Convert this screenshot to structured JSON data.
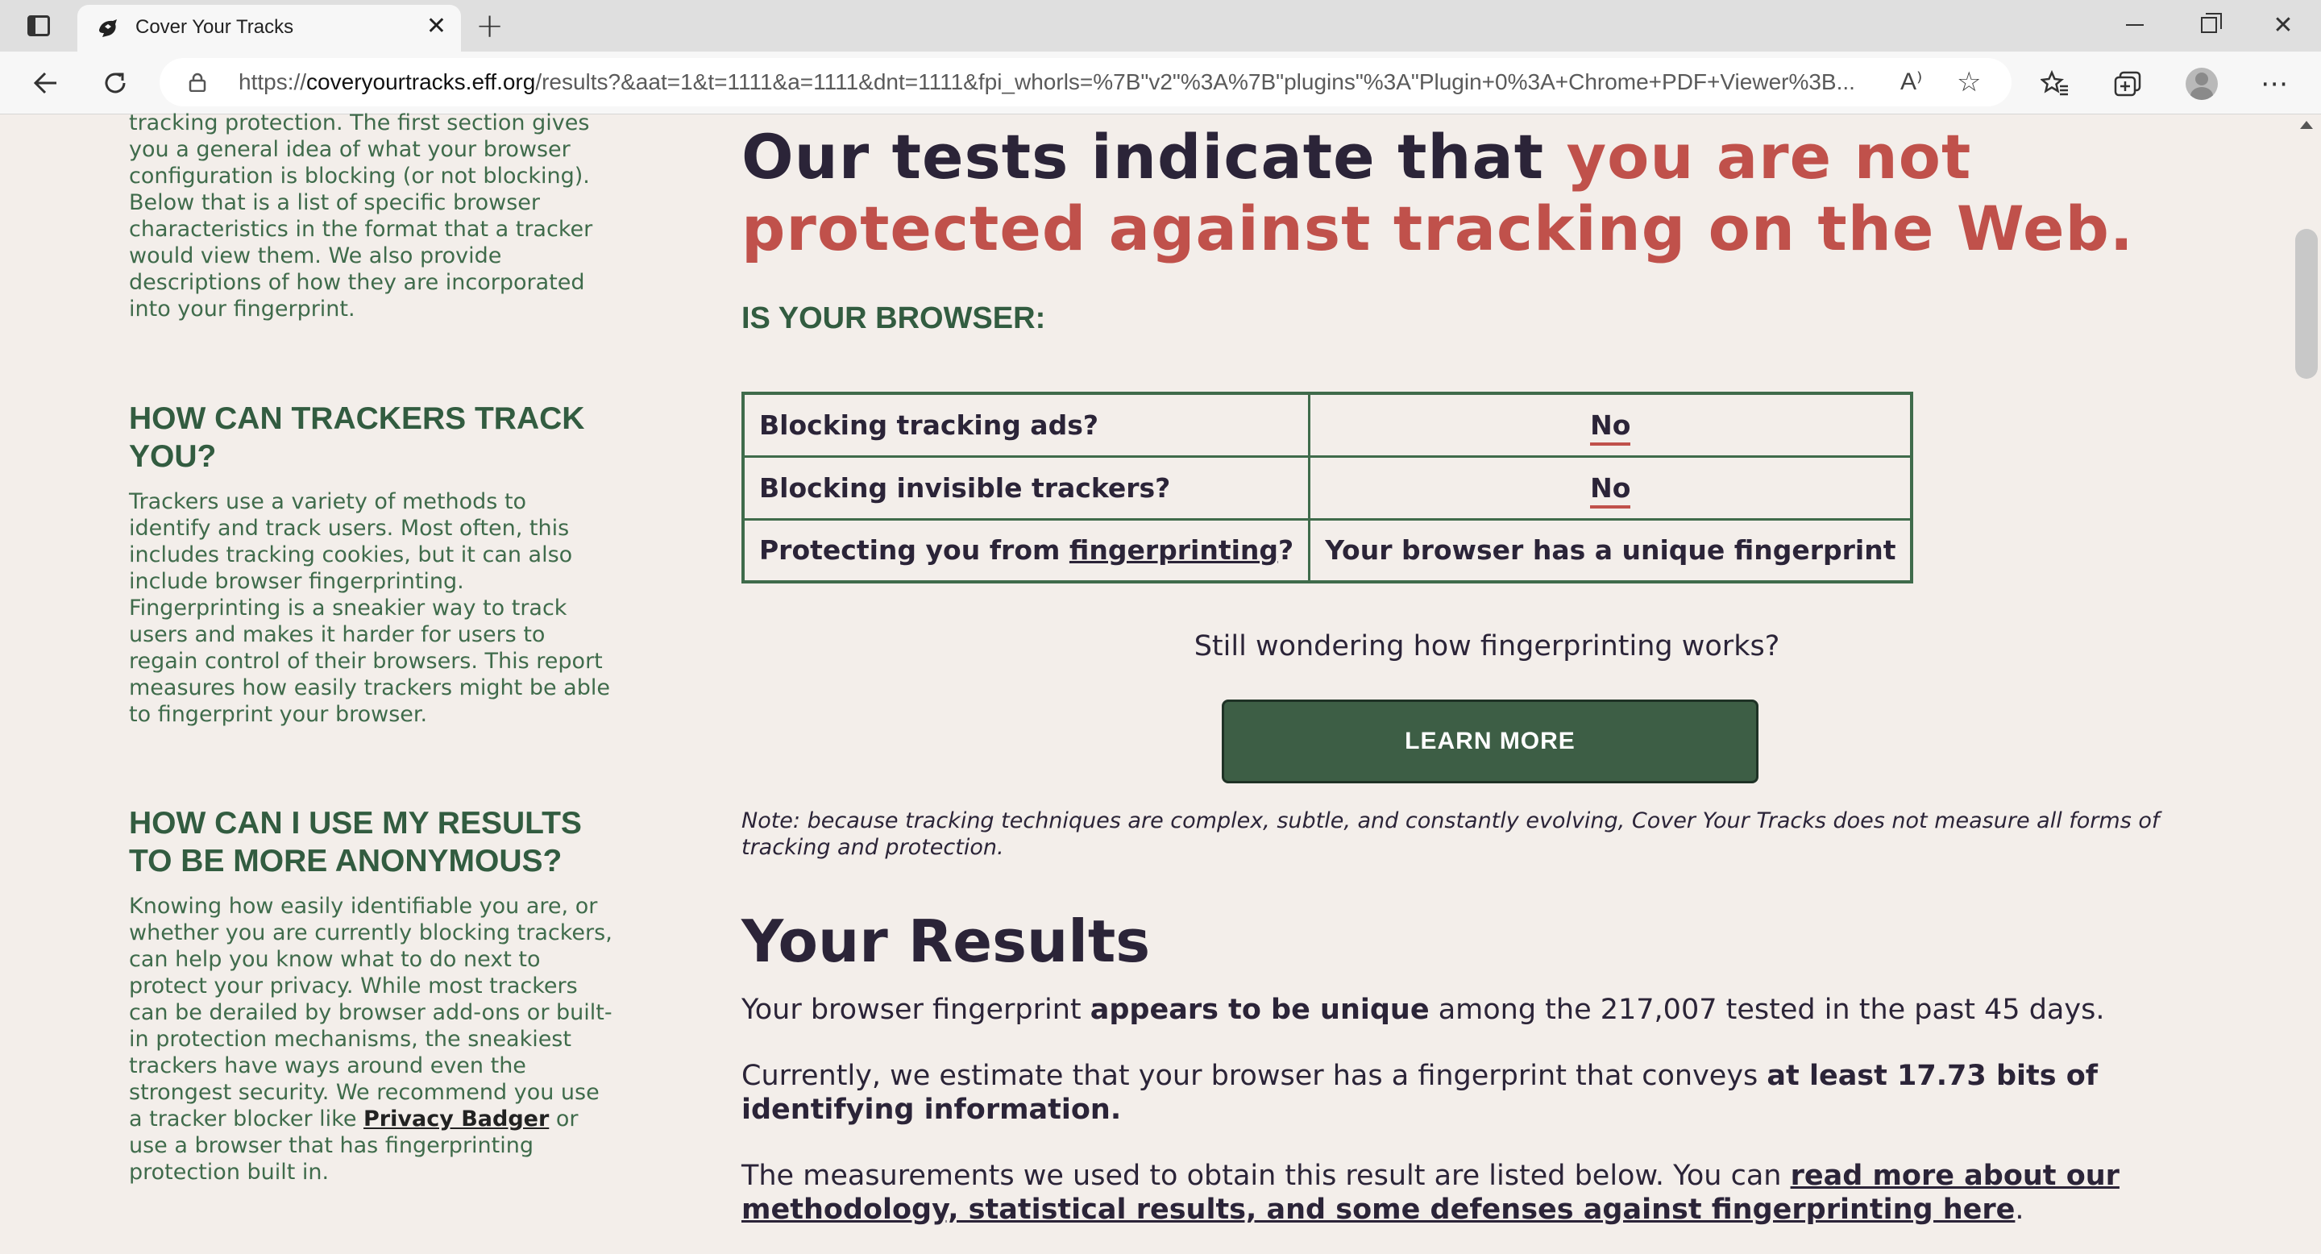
{
  "browser": {
    "tab_title": "Cover Your Tracks",
    "url_prefix": "https://",
    "url_host": "coveryourtracks.eff.org",
    "url_rest": "/results?&aat=1&t=1111&a=1111&dnt=1111&fpi_whorls=%7B\"v2\"%3A%7B\"plugins\"%3A\"Plugin+0%3A+Chrome+PDF+Viewer%3B...",
    "read_aloud_label": "A⁾"
  },
  "sidebar": {
    "intro_tail": "tracking protection. The first section gives you a general idea of what your browser configuration is blocking (or not blocking). Below that is a list of specific browser characteristics in the format that a tracker would view them. We also provide descriptions of how they are incorporated into your fingerprint.",
    "track_heading": "HOW CAN TRACKERS TRACK YOU?",
    "track_body": "Trackers use a variety of methods to identify and track users. Most often, this includes tracking cookies, but it can also include browser fingerprinting. Fingerprinting is a sneakier way to track users and makes it harder for users to regain control of their browsers. This report measures how easily trackers might be able to fingerprint your browser.",
    "anon_heading": "HOW CAN I USE MY RESULTS TO BE MORE ANONYMOUS?",
    "anon_body_1": "Knowing how easily identifiable you are, or whether you are currently blocking trackers, can help you know what to do next to protect your privacy. While most trackers can be derailed by browser add-ons or built-in protection mechanisms, the sneakiest trackers have ways around even the strongest security. We recommend you use a tracker blocker like ",
    "anon_link": "Privacy Badger",
    "anon_body_2": " or use a browser that has fingerprinting protection built in."
  },
  "main": {
    "headline_dark": "Our tests indicate that ",
    "headline_red": "you are not protected against tracking on the Web.",
    "question_heading": "IS YOUR BROWSER:",
    "table": {
      "row1_q": "Blocking tracking ads?",
      "row1_a": "No",
      "row2_q": "Blocking invisible trackers?",
      "row2_a": "No",
      "row3_q_prefix": "Protecting you from ",
      "row3_q_link": "fingerprinting",
      "row3_q_suffix": "?",
      "row3_a": "Your browser has a unique fingerprint"
    },
    "still_wondering": "Still wondering how fingerprinting works?",
    "learn_more": "LEARN MORE",
    "note": "Note: because tracking techniques are complex, subtle, and constantly evolving, Cover Your Tracks does not measure all forms of tracking and protection.",
    "results_title": "Your Results",
    "res1_a": "Your browser fingerprint ",
    "res1_b": "appears to be unique",
    "res1_c": " among the 217,007 tested in the past 45 days.",
    "res2_a": "Currently, we estimate that your browser has a fingerprint that conveys ",
    "res2_b": "at least 17.73 bits of identifying information.",
    "res3_a": "The measurements we used to obtain this result are listed below. You can ",
    "res3_link": "read more about our methodology, statistical results, and some defenses against fingerprinting here",
    "res3_c": "."
  },
  "colors": {
    "accent_green": "#3d5e45",
    "accent_red": "#c0514b",
    "page_bg": "#f3eeea"
  },
  "icons": [
    "tab-actions-icon",
    "eff-favicon",
    "close-icon",
    "plus-icon",
    "minimize-icon",
    "restore-icon",
    "window-close-icon",
    "back-arrow-icon",
    "reload-icon",
    "lock-icon",
    "read-aloud-icon",
    "add-favorite-icon",
    "favorites-icon",
    "collections-icon",
    "profile-icon",
    "more-menu-icon"
  ]
}
